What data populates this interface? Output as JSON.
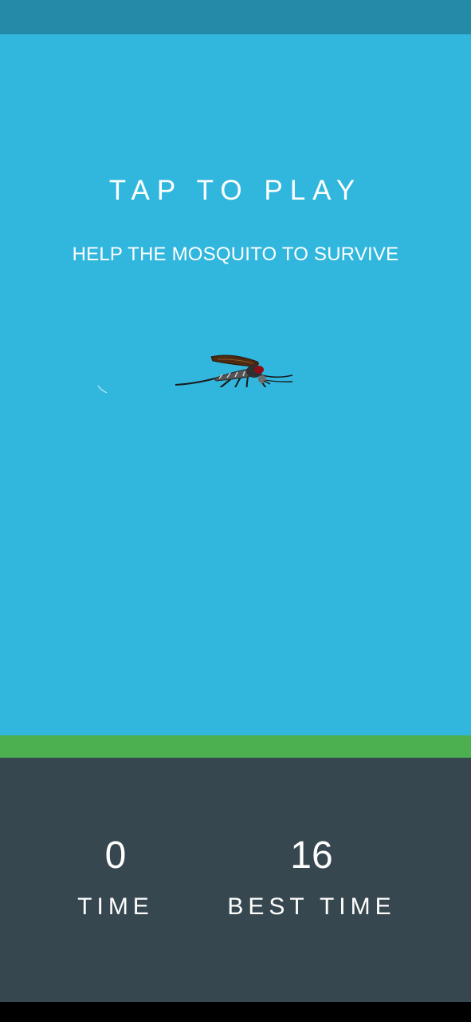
{
  "game": {
    "title": "TAP TO PLAY",
    "subtitle": "HELP THE MOSQUITO TO SURVIVE"
  },
  "scores": {
    "time_value": "0",
    "time_label": "TIME",
    "best_value": "16",
    "best_label": "BEST TIME"
  },
  "colors": {
    "status_bar": "#2589a8",
    "sky": "#31b7de",
    "ground": "#4caf50",
    "panel": "#37474f",
    "nav_bar": "#000000",
    "text": "#ffffff"
  },
  "icons": {
    "player": "mosquito-icon"
  }
}
